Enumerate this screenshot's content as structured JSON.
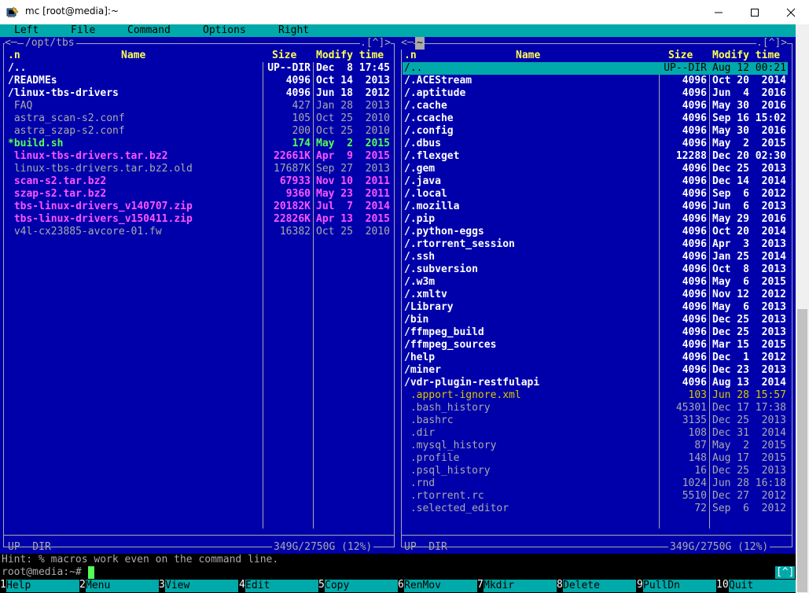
{
  "window": {
    "title": "mc [root@media]:~"
  },
  "menu": [
    "Left",
    "File",
    "Command",
    "Options",
    "Right"
  ],
  "left_panel": {
    "path": "/opt/tbs",
    "controls": ".[^]>",
    "columns": {
      "name": "Name",
      "sort": ".n",
      "size": "Size",
      "time": "Modify time"
    },
    "files": [
      {
        "name": "/..",
        "size": "UP--DIR",
        "date": "Dec  8 17:45",
        "type": "dir"
      },
      {
        "name": "/READMEs",
        "size": "4096",
        "date": "Oct 14  2013",
        "type": "dir"
      },
      {
        "name": "/linux-tbs-drivers",
        "size": "4096",
        "date": "Jun 18  2012",
        "type": "dir"
      },
      {
        "name": " FAQ",
        "size": "427",
        "date": "Jan 28  2013",
        "type": "file"
      },
      {
        "name": " astra_scan-s2.conf",
        "size": "105",
        "date": "Oct 25  2010",
        "type": "file"
      },
      {
        "name": " astra_szap-s2.conf",
        "size": "200",
        "date": "Oct 25  2010",
        "type": "file"
      },
      {
        "name": "*build.sh",
        "size": "174",
        "date": "May  2  2015",
        "type": "exec"
      },
      {
        "name": " linux-tbs-drivers.tar.bz2",
        "size": "22661K",
        "date": "Apr  9  2015",
        "type": "arch"
      },
      {
        "name": " linux-tbs-drivers.tar.bz2.old",
        "size": "17687K",
        "date": "Sep 27  2013",
        "type": "file"
      },
      {
        "name": " scan-s2.tar.bz2",
        "size": "67933",
        "date": "Nov 10  2011",
        "type": "arch"
      },
      {
        "name": " szap-s2.tar.bz2",
        "size": "9360",
        "date": "May 23  2011",
        "type": "arch"
      },
      {
        "name": " tbs-linux-drivers_v140707.zip",
        "size": "20182K",
        "date": "Jul  7  2014",
        "type": "arch"
      },
      {
        "name": " tbs-linux-drivers_v150411.zip",
        "size": "22826K",
        "date": "Apr 13  2015",
        "type": "arch"
      },
      {
        "name": " v4l-cx23885-avcore-01.fw",
        "size": "16382",
        "date": "Oct 25  2010",
        "type": "file"
      }
    ],
    "status": "UP--DIR",
    "disk": "349G/2750G (12%)"
  },
  "right_panel": {
    "path": "~",
    "controls": ".[^]>",
    "columns": {
      "name": "Name",
      "sort": ".n",
      "size": "Size",
      "time": "Modify time"
    },
    "files": [
      {
        "name": "/..",
        "size": "UP--DIR",
        "date": "Aug 12 00:21",
        "type": "sel"
      },
      {
        "name": "/.ACEStream",
        "size": "4096",
        "date": "Oct 20  2014",
        "type": "dir"
      },
      {
        "name": "/.aptitude",
        "size": "4096",
        "date": "Jun  4  2016",
        "type": "dir"
      },
      {
        "name": "/.cache",
        "size": "4096",
        "date": "May 30  2016",
        "type": "dir"
      },
      {
        "name": "/.ccache",
        "size": "4096",
        "date": "Sep 16 15:02",
        "type": "dir"
      },
      {
        "name": "/.config",
        "size": "4096",
        "date": "May 30  2016",
        "type": "dir"
      },
      {
        "name": "/.dbus",
        "size": "4096",
        "date": "May  2  2015",
        "type": "dir"
      },
      {
        "name": "/.flexget",
        "size": "12288",
        "date": "Dec 20 02:30",
        "type": "dir"
      },
      {
        "name": "/.gem",
        "size": "4096",
        "date": "Dec 25  2013",
        "type": "dir"
      },
      {
        "name": "/.java",
        "size": "4096",
        "date": "Dec 14  2014",
        "type": "dir"
      },
      {
        "name": "/.local",
        "size": "4096",
        "date": "Sep  6  2012",
        "type": "dir"
      },
      {
        "name": "/.mozilla",
        "size": "4096",
        "date": "Jun  6  2013",
        "type": "dir"
      },
      {
        "name": "/.pip",
        "size": "4096",
        "date": "May 29  2016",
        "type": "dir"
      },
      {
        "name": "/.python-eggs",
        "size": "4096",
        "date": "Oct 20  2014",
        "type": "dir"
      },
      {
        "name": "/.rtorrent_session",
        "size": "4096",
        "date": "Apr  3  2013",
        "type": "dir"
      },
      {
        "name": "/.ssh",
        "size": "4096",
        "date": "Jan 25  2014",
        "type": "dir"
      },
      {
        "name": "/.subversion",
        "size": "4096",
        "date": "Oct  8  2013",
        "type": "dir"
      },
      {
        "name": "/.w3m",
        "size": "4096",
        "date": "May  6  2015",
        "type": "dir"
      },
      {
        "name": "/.xmltv",
        "size": "4096",
        "date": "Nov 12  2012",
        "type": "dir"
      },
      {
        "name": "/Library",
        "size": "4096",
        "date": "May  6  2013",
        "type": "dir"
      },
      {
        "name": "/bin",
        "size": "4096",
        "date": "Dec 25  2013",
        "type": "dir"
      },
      {
        "name": "/ffmpeg_build",
        "size": "4096",
        "date": "Dec 25  2013",
        "type": "dir"
      },
      {
        "name": "/ffmpeg_sources",
        "size": "4096",
        "date": "Mar 15  2015",
        "type": "dir"
      },
      {
        "name": "/help",
        "size": "4096",
        "date": "Dec  1  2012",
        "type": "dir"
      },
      {
        "name": "/miner",
        "size": "4096",
        "date": "Dec 23  2013",
        "type": "dir"
      },
      {
        "name": "/vdr-plugin-restfulapi",
        "size": "4096",
        "date": "Aug 13  2014",
        "type": "dir"
      },
      {
        "name": " .apport-ignore.xml",
        "size": "103",
        "date": "Jun 28 15:57",
        "type": "core"
      },
      {
        "name": " .bash_history",
        "size": "45301",
        "date": "Dec 17 17:38",
        "type": "file"
      },
      {
        "name": " .bashrc",
        "size": "3135",
        "date": "Dec 25  2013",
        "type": "file"
      },
      {
        "name": " .dir",
        "size": "108",
        "date": "Dec 31  2014",
        "type": "file"
      },
      {
        "name": " .mysql_history",
        "size": "87",
        "date": "May  2  2015",
        "type": "file"
      },
      {
        "name": " .profile",
        "size": "148",
        "date": "Aug 17  2015",
        "type": "file"
      },
      {
        "name": " .psql_history",
        "size": "16",
        "date": "Dec 25  2013",
        "type": "file"
      },
      {
        "name": " .rnd",
        "size": "1024",
        "date": "Jun 28 16:18",
        "type": "file"
      },
      {
        "name": " .rtorrent.rc",
        "size": "5510",
        "date": "Dec 27  2012",
        "type": "file"
      },
      {
        "name": " .selected_editor",
        "size": "72",
        "date": "Sep  6  2012",
        "type": "file"
      }
    ],
    "status": "UP--DIR",
    "disk": "349G/2750G (12%)"
  },
  "hint": "Hint: % macros work even on the command line.",
  "prompt": "root@media:~#",
  "cmd_controls": "[^]",
  "fkeys": [
    {
      "num": "1",
      "label": "Help"
    },
    {
      "num": "2",
      "label": "Menu"
    },
    {
      "num": "3",
      "label": "View"
    },
    {
      "num": "4",
      "label": "Edit"
    },
    {
      "num": "5",
      "label": "Copy"
    },
    {
      "num": "6",
      "label": "RenMov"
    },
    {
      "num": "7",
      "label": "Mkdir"
    },
    {
      "num": "8",
      "label": "Delete"
    },
    {
      "num": "9",
      "label": "PullDn"
    },
    {
      "num": "10",
      "label": "Quit"
    }
  ],
  "colors": {
    "panel_bg": "#0000aa",
    "menu_bg": "#00aaaa",
    "header": "#ffff55",
    "dir": "#ffffff",
    "file": "#aaaaaa",
    "exec": "#55ff55",
    "archive": "#ff55ff",
    "selection": "#00aaaa"
  },
  "icons": {
    "app": "mc-terminal-icon",
    "minimize": "minimize-icon",
    "maximize": "maximize-icon",
    "close": "close-icon"
  }
}
